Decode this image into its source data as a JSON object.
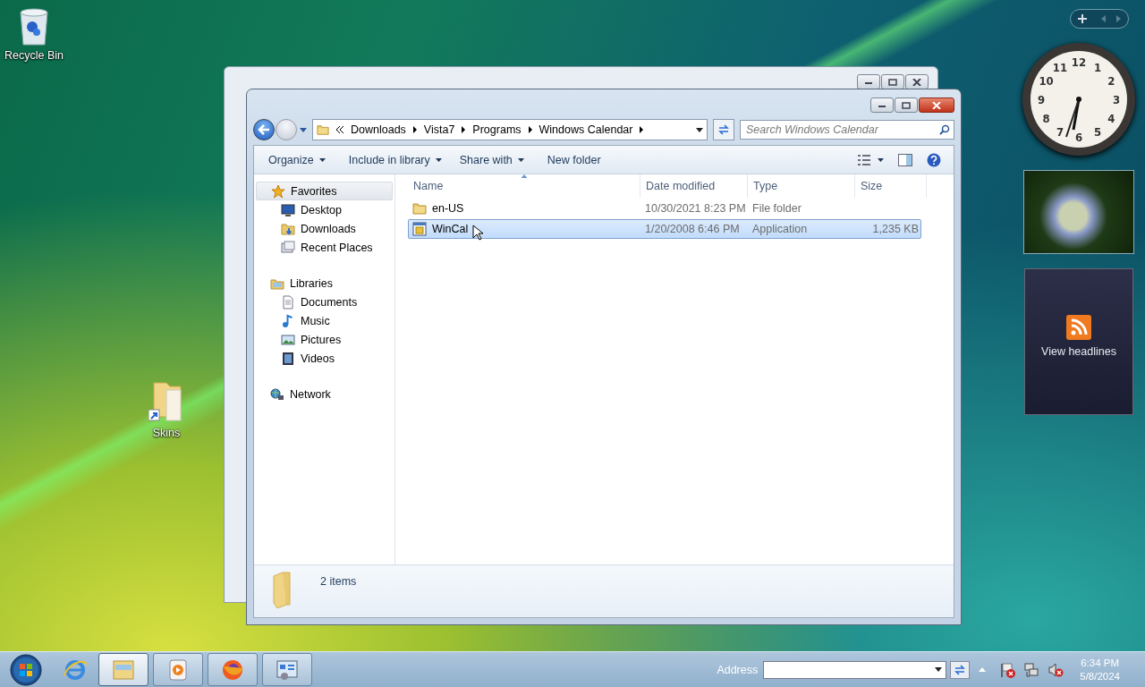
{
  "desktop_icons": [
    {
      "label": "Recycle Bin",
      "kind": "recycle-bin"
    },
    {
      "label": "Skins",
      "kind": "folder-shortcut"
    }
  ],
  "explorer": {
    "breadcrumb": [
      "Downloads",
      "Vista7",
      "Programs",
      "Windows Calendar"
    ],
    "search": {
      "placeholder": "Search Windows Calendar"
    },
    "toolbar": [
      {
        "label": "Organize",
        "dropdown": true
      },
      {
        "label": "Include in library",
        "dropdown": true
      },
      {
        "label": "Share with",
        "dropdown": true
      },
      {
        "label": "New folder",
        "dropdown": false
      }
    ],
    "sidebar": [
      {
        "label": "Favorites",
        "kind": "star",
        "selected": true,
        "children": [
          {
            "label": "Desktop",
            "kind": "desktop",
            "selected": false
          },
          {
            "label": "Downloads",
            "kind": "downloads",
            "selected": false
          },
          {
            "label": "Recent Places",
            "kind": "recent",
            "selected": false
          }
        ]
      },
      {
        "label": "Libraries",
        "kind": "libraries",
        "selected": false,
        "children": [
          {
            "label": "Documents",
            "kind": "documents",
            "selected": false
          },
          {
            "label": "Music",
            "kind": "music",
            "selected": false
          },
          {
            "label": "Pictures",
            "kind": "pictures",
            "selected": false
          },
          {
            "label": "Videos",
            "kind": "videos",
            "selected": false
          }
        ]
      },
      {
        "label": "Network",
        "kind": "network",
        "selected": false
      }
    ],
    "columns": [
      {
        "label": "Name",
        "sorted": true
      },
      {
        "label": "Date modified",
        "sorted": false
      },
      {
        "label": "Type",
        "sorted": false
      },
      {
        "label": "Size",
        "sorted": false
      }
    ],
    "rows": [
      {
        "kind": "folder",
        "name": "en-US",
        "date": "10/30/2021 8:23 PM",
        "type": "File folder",
        "selected": false
      },
      {
        "kind": "application",
        "name": "WinCal",
        "date": "1/20/2008 6:46 PM",
        "type": "Application",
        "size": "1,235 KB",
        "selected": true
      }
    ],
    "status": "2 items"
  },
  "gadgets": {
    "clock": {
      "numerals": [
        "12",
        "11",
        "1",
        "10",
        "2",
        "9",
        "3",
        "8",
        "4",
        "7",
        "5",
        "6"
      ]
    },
    "feed": {
      "label": "View headlines"
    }
  },
  "taskbar": {
    "buttons": [
      {
        "kind": "browser",
        "running": false,
        "selected": false
      },
      {
        "kind": "explorer",
        "running": true,
        "selected": true
      },
      {
        "kind": "media",
        "running": true,
        "selected": false
      },
      {
        "kind": "firefox",
        "running": true,
        "selected": false
      },
      {
        "kind": "control-panel",
        "running": true,
        "selected": false
      }
    ],
    "address": {
      "label": "Address"
    },
    "time": "6:34 PM",
    "date": "5/8/2024"
  }
}
